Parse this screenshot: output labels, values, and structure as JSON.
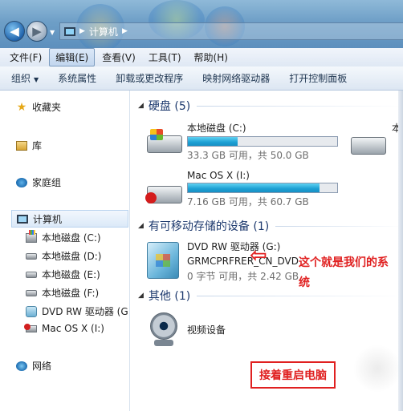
{
  "address": {
    "path": "计算机"
  },
  "menu": [
    {
      "label": "文件(F)"
    },
    {
      "label": "编辑(E)"
    },
    {
      "label": "查看(V)"
    },
    {
      "label": "工具(T)"
    },
    {
      "label": "帮助(H)"
    }
  ],
  "commands": {
    "organize": "组织",
    "properties": "系统属性",
    "uninstall": "卸载或更改程序",
    "map_drive": "映射网络驱动器",
    "control_panel": "打开控制面板"
  },
  "nav": {
    "favorites": "收藏夹",
    "libraries": "库",
    "homegroup": "家庭组",
    "computer": "计算机",
    "drives": [
      "本地磁盘 (C:)",
      "本地磁盘 (D:)",
      "本地磁盘 (E:)",
      "本地磁盘 (F:)",
      "DVD RW 驱动器 (G",
      "Mac OS X (I:)"
    ],
    "network": "网络"
  },
  "groups": {
    "hdd": "硬盘 (5)",
    "removable": "有可移动存储的设备 (1)",
    "other": "其他 (1)"
  },
  "drives": [
    {
      "name": "本地磁盘 (C:)",
      "free_text": "33.3 GB 可用，共 50.0 GB",
      "used_fraction": 0.334
    },
    {
      "name": "Mac OS X (I:)",
      "free_text": "7.16 GB 可用，共 60.7 GB",
      "used_fraction": 0.882
    }
  ],
  "partial_drive_name": "本",
  "dvd": {
    "name": "DVD RW 驱动器 (G:)",
    "label": "GRMCPRFRER_CN_DVD",
    "free_text": "0 字节 可用，共 2.42 GB"
  },
  "other_device": "视频设备",
  "annotations": {
    "system_line1": "这个就是我们的系",
    "system_line2": "统",
    "restart": "接着重启电脑",
    "arrow": "⇦"
  },
  "colors": {
    "annotation": "#e02020",
    "bar_fill": "#1c9fd3",
    "group_header": "#1e3a6e"
  }
}
